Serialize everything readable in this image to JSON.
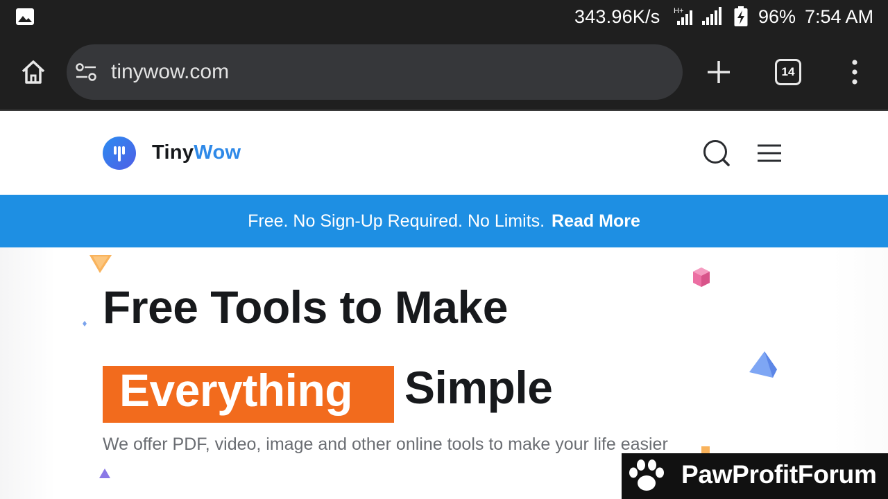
{
  "status_bar": {
    "network_speed": "343.96K/s",
    "network_type": "H+",
    "battery": "96%",
    "time": "7:54 AM",
    "icons": [
      "gallery-icon",
      "signal-icon",
      "battery-charging-icon"
    ]
  },
  "browser": {
    "url": "tinywow.com",
    "tab_count": "14",
    "icons": [
      "home-icon",
      "site-settings-icon",
      "new-tab-icon",
      "tab-switcher-icon",
      "more-menu-icon"
    ]
  },
  "site": {
    "logo_text_1": "Tiny",
    "logo_text_2": "Wow",
    "brand_color": "#2e89e8",
    "icons": [
      "search-icon",
      "hamburger-menu-icon"
    ]
  },
  "banner": {
    "text": "Free. No Sign-Up Required. No Limits.",
    "link": "Read More",
    "color": "#1e8fe3"
  },
  "hero": {
    "line1": "Free Tools to Make",
    "highlight": "Everything",
    "line2": "Simple",
    "subtitle": "We offer PDF, video, image and other online tools to make your life easier",
    "highlight_color": "#f26b1d"
  },
  "watermark": {
    "text": "PawProfitForum"
  }
}
